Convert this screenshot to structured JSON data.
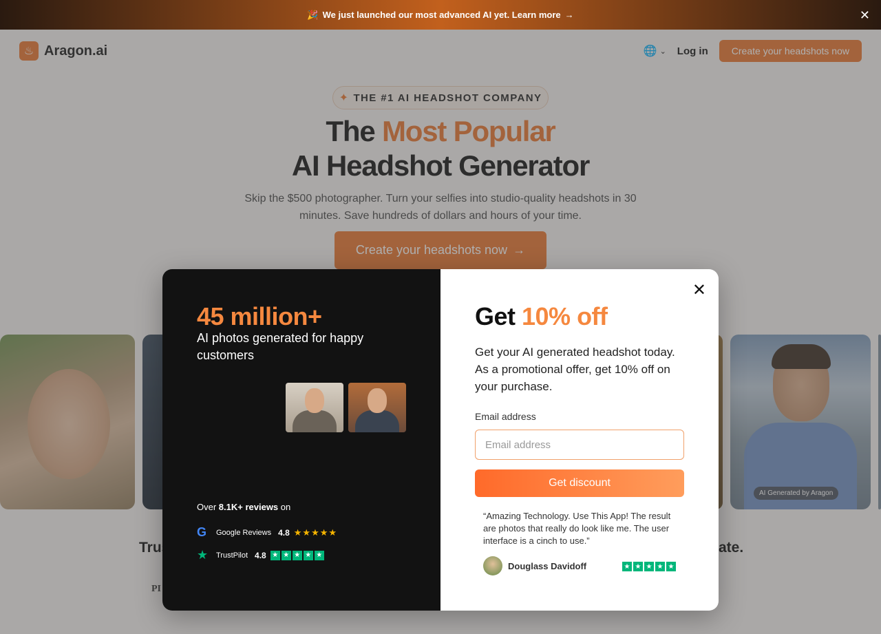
{
  "announcement": {
    "emoji": "🎉",
    "text": "We just launched our most advanced AI yet. Learn more",
    "arrow": "→",
    "close": "✕"
  },
  "header": {
    "logo_text": "Aragon.ai",
    "globe": "🌐",
    "chevron": "⌄",
    "login": "Log in",
    "cta": "Create your headshots now"
  },
  "hero": {
    "badge_icon": "✦",
    "badge": "THE #1 AI HEADSHOT COMPANY",
    "title_pre": "The ",
    "title_accent": "Most Popular",
    "title_line2": "AI Headshot Generator",
    "subtitle": "Skip the $500 photographer. Turn your selfies into studio-quality headshots in 30 minutes. Save hundreds of dollars and hours of your time.",
    "cta": "Create your headshots now",
    "cta_arrow": "→"
  },
  "strip": {
    "ai_badge": "AI Generated by Aragon"
  },
  "background": {
    "trust_left": "Trus",
    "trust_right": "ate.",
    "press": "PI"
  },
  "modal": {
    "left": {
      "stat": "45 million+",
      "stat_desc": "AI photos generated for happy customers",
      "reviews_prefix": "Over ",
      "reviews_count": "8.1K+ reviews",
      "reviews_suffix": " on",
      "google": {
        "icon": "G",
        "label": "Google Reviews",
        "rating": "4.8",
        "stars": "★★★★★"
      },
      "trustpilot": {
        "icon": "★",
        "label": "TrustPilot",
        "rating": "4.8",
        "stars": [
          "★",
          "★",
          "★",
          "★",
          "★"
        ]
      }
    },
    "right": {
      "close": "✕",
      "title_pre": "Get ",
      "title_accent": "10% off",
      "promo": "Get your AI generated headshot today. As a promotional offer, get 10% off on your purchase.",
      "email_label": "Email address",
      "email_placeholder": "Email address",
      "button": "Get discount",
      "quote": "“Amazing Technology. Use This App! The result are photos that really do look like me. The user interface is a cinch to use.”",
      "reviewer": "Douglass Davidoff",
      "stars": [
        "★",
        "★",
        "★",
        "★",
        "★"
      ]
    }
  },
  "colors": {
    "accent": "#e8742c",
    "highlight": "#f5883f",
    "trustpilot": "#00b67a",
    "google_star": "#f5b400"
  }
}
